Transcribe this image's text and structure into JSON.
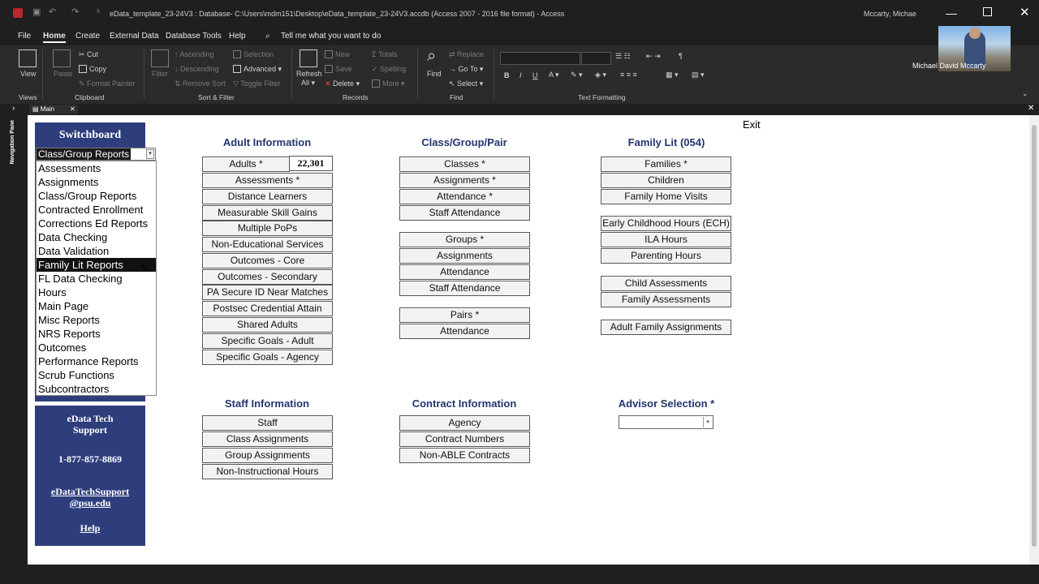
{
  "window": {
    "title": "eData_template_23-24V3 : Database- C:\\Users\\mdm151\\Desktop\\eData_template_23-24V3.accdb (Access 2007 - 2016 file format) - Access",
    "user": "Mccarty, Michae"
  },
  "menu": {
    "items": [
      "File",
      "Home",
      "Create",
      "External Data",
      "Database Tools",
      "Help"
    ],
    "active": "Home",
    "tell_me": "Tell me what you want to do"
  },
  "ribbon": {
    "views": {
      "view_label": "View",
      "group": "Views"
    },
    "clipboard": {
      "paste": "Paste",
      "cut": "Cut",
      "copy": "Copy",
      "format_painter": "Format Painter",
      "group": "Clipboard"
    },
    "sort_filter": {
      "filter": "Filter",
      "ascending": "Ascending",
      "descending": "Descending",
      "remove_sort": "Remove Sort",
      "selection": "Selection",
      "advanced": "Advanced",
      "toggle_filter": "Toggle Filter",
      "group": "Sort & Filter"
    },
    "records": {
      "refresh": "Refresh",
      "refresh_all": "All",
      "new": "New",
      "save": "Save",
      "delete": "Delete",
      "totals": "Totals",
      "spelling": "Spelling",
      "more": "More",
      "group": "Records"
    },
    "find": {
      "find": "Find",
      "replace": "Replace",
      "goto": "Go To",
      "select": "Select",
      "group": "Find"
    },
    "text_formatting": {
      "group": "Text Formatting",
      "bold": "B",
      "italic": "I",
      "underline": "U"
    }
  },
  "doc_tab": {
    "label": "Main"
  },
  "nav_pane": {
    "label": "Navigation Pane"
  },
  "switchboard": {
    "title": "Switchboard",
    "selected": "Class/Group Reports",
    "options": [
      "Assessments",
      "Assignments",
      "Class/Group Reports",
      "Contracted Enrollment",
      "Corrections Ed Reports",
      "Data Checking",
      "Data Validation",
      "Family Lit Reports",
      "FL Data Checking",
      "Hours",
      "Main Page",
      "Misc Reports",
      "NRS Reports",
      "Outcomes",
      "Performance Reports",
      "Scrub Functions",
      "Subcontractors"
    ],
    "highlighted": "Family Lit Reports"
  },
  "support": {
    "line1": "eData Tech",
    "line2": "Support",
    "phone": "1-877-857-8869",
    "email1": "eDataTechSupport",
    "email2": "@psu.edu",
    "help": "Help"
  },
  "exit_label": "Exit",
  "sections": {
    "adult": {
      "title": "Adult Information",
      "count": "22,301",
      "buttons": [
        "Adults *",
        "Assessments *",
        "Distance Learners",
        "Measurable Skill Gains",
        "Multiple PoPs",
        "Non-Educational Services",
        "Outcomes - Core",
        "Outcomes - Secondary",
        "PA Secure ID Near Matches",
        "Postsec Credential Attain",
        "Shared Adults",
        "Specific Goals - Adult",
        "Specific Goals - Agency"
      ]
    },
    "class": {
      "title": "Class/Group/Pair",
      "buttons": [
        "Classes *",
        "Assignments *",
        "Attendance *",
        "Staff Attendance",
        "Groups *",
        "Assignments",
        "Attendance",
        "Staff Attendance",
        "Pairs *",
        "Attendance"
      ]
    },
    "family": {
      "title": "Family Lit (054)",
      "buttons": [
        "Families *",
        "Children",
        "Family Home Visits",
        "Early Childhood Hours (ECH)",
        "ILA Hours",
        "Parenting Hours",
        "Child Assessments",
        "Family Assessments",
        "Adult Family Assignments"
      ]
    },
    "staff": {
      "title": "Staff  Information",
      "buttons": [
        "Staff",
        "Class Assignments",
        "Group Assignments",
        "Non-Instructional Hours"
      ]
    },
    "contract": {
      "title": "Contract  Information",
      "buttons": [
        "Agency",
        "Contract Numbers",
        "Non-ABLE Contracts"
      ]
    },
    "advisor": {
      "title": "Advisor Selection *",
      "value": ""
    }
  },
  "webcam": {
    "name": "Michael David Mccarty"
  }
}
